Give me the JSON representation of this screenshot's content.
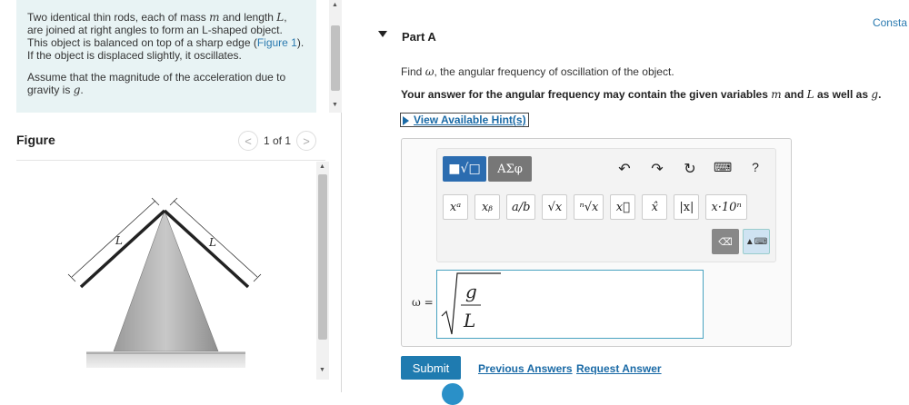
{
  "problem": {
    "text1": "Two identical thin rods, each of mass",
    "m": "m",
    "text2": "and length",
    "L": "L",
    "text3": ", are joined at right angles to form an L-shaped object. This object is balanced on top of a sharp edge (",
    "figure_link": "Figure 1",
    "text4": "). If the object is displaced slightly, it oscillates.",
    "text5": "Assume that the magnitude of the acceleration due to gravity is",
    "g": "g",
    "period": "."
  },
  "figure": {
    "heading": "Figure",
    "pager_text": "1 of 1",
    "prev_glyph": "<",
    "next_glyph": ">",
    "rod_label_left": "L",
    "rod_label_right": "L"
  },
  "part": {
    "top_link": "Consta",
    "label": "Part A",
    "find_prefix": "Find",
    "omega": "ω",
    "find_suffix": ", the angular frequency of oscillation of the object.",
    "answer_note_prefix": "Your answer for the angular frequency may contain the given variables",
    "answer_note_m": "m",
    "answer_note_and": "and",
    "answer_note_L": "L",
    "answer_note_suffix": "as well as",
    "answer_note_g": "g",
    "answer_note_end": ".",
    "hint_link": "View Available Hint(s)"
  },
  "toolbar": {
    "template_btn": "■√□",
    "greek_btn": "ΑΣφ",
    "undo_icon": "↶",
    "redo_icon": "↷",
    "reset_icon": "↻",
    "keyboard_icon": "⌨",
    "help_icon": "?",
    "keys": [
      "xᵃ",
      "xᵦ",
      "a/b",
      "√x",
      "ⁿ√x",
      "x⃗",
      "x̂",
      "|x|",
      "x·10ⁿ"
    ],
    "backspace": "⌫",
    "keyboard_toggle": "▲⌨"
  },
  "answer": {
    "label": "ω =",
    "numerator": "g",
    "denominator": "L"
  },
  "actions": {
    "submit": "Submit",
    "previous_answers": "Previous Answers",
    "request_answer": "Request Answer"
  }
}
